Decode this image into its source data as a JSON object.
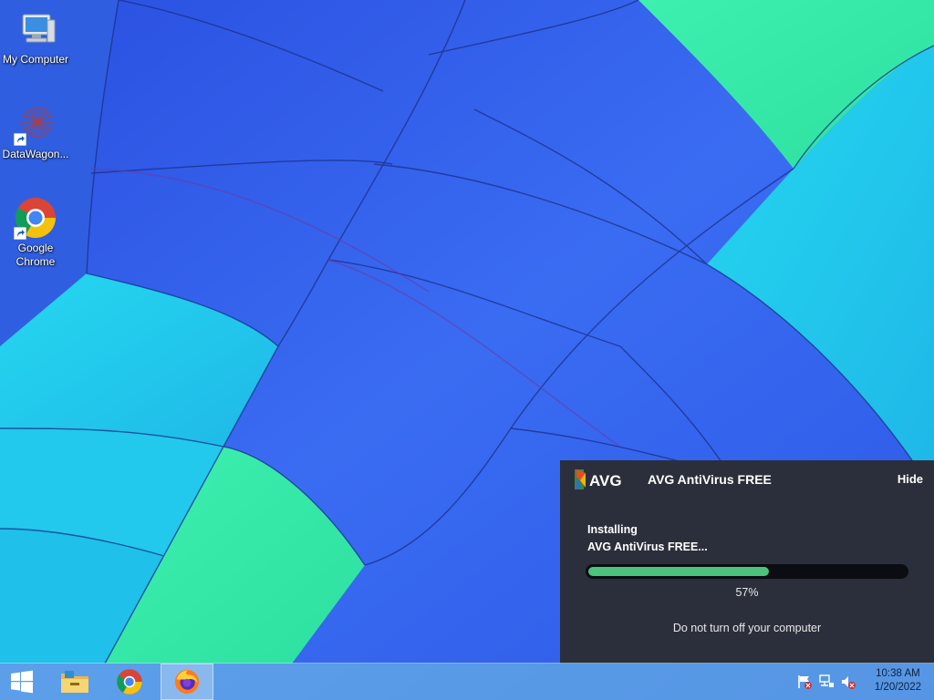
{
  "desktop": {
    "icons": [
      {
        "label": "My Computer"
      },
      {
        "label": "DataWagon..."
      },
      {
        "label": "Google Chrome"
      }
    ]
  },
  "avg": {
    "brand": "AVG",
    "title": "AVG AntiVirus FREE",
    "hide_label": "Hide",
    "status_line1": "Installing",
    "status_line2": "AVG AntiVirus FREE...",
    "progress": 0.57,
    "percent_label": "57%",
    "warning": "Do not turn off your computer",
    "colors": {
      "panel": "#2b2f3b",
      "progress_fill": "#4cc37a",
      "progress_track": "#0b0d12"
    }
  },
  "taskbar": {
    "apps": [
      {
        "icon": "start-windows-icon"
      },
      {
        "icon": "file-explorer-icon"
      },
      {
        "icon": "chrome-icon"
      },
      {
        "icon": "firefox-icon",
        "active": true
      }
    ],
    "tray": [
      {
        "icon": "action-center-flag-icon"
      },
      {
        "icon": "network-icon"
      },
      {
        "icon": "volume-muted-icon"
      }
    ],
    "clock": {
      "time": "10:38 AM",
      "date": "1/20/2022"
    }
  }
}
